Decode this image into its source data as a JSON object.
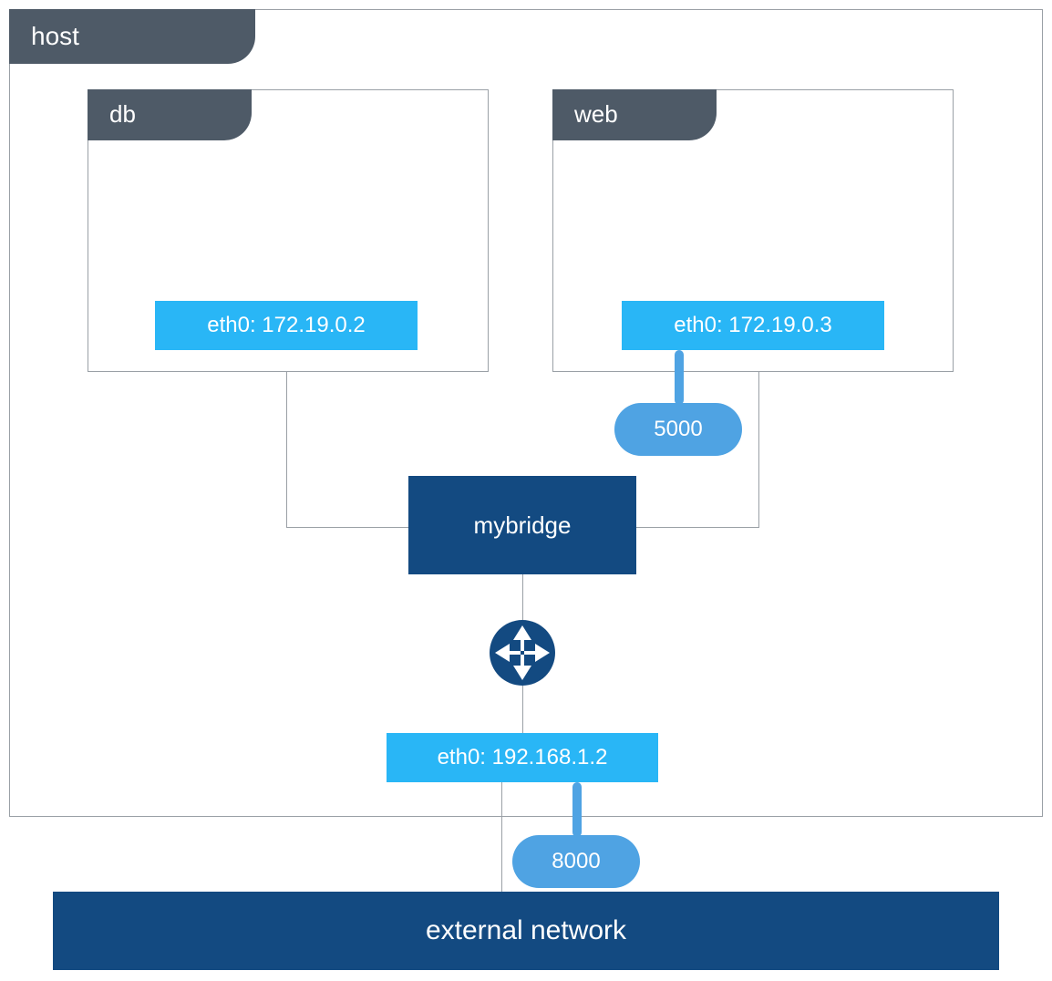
{
  "diagram": {
    "host_label": "host",
    "containers": {
      "db": {
        "label": "db",
        "interface_label": "eth0: 172.19.0.2"
      },
      "web": {
        "label": "web",
        "interface_label": "eth0: 172.19.0.3",
        "internal_port": "5000"
      }
    },
    "bridge_label": "mybridge",
    "host_interface_label": "eth0: 192.168.1.2",
    "external_port": "8000",
    "external_network_label": "external network"
  },
  "colors": {
    "tab_bg": "#4e5a67",
    "container_border": "#9aa0a6",
    "interface_bg": "#29b6f6",
    "dark_blue": "#134a81",
    "port_pill": "#4fa3e3"
  }
}
